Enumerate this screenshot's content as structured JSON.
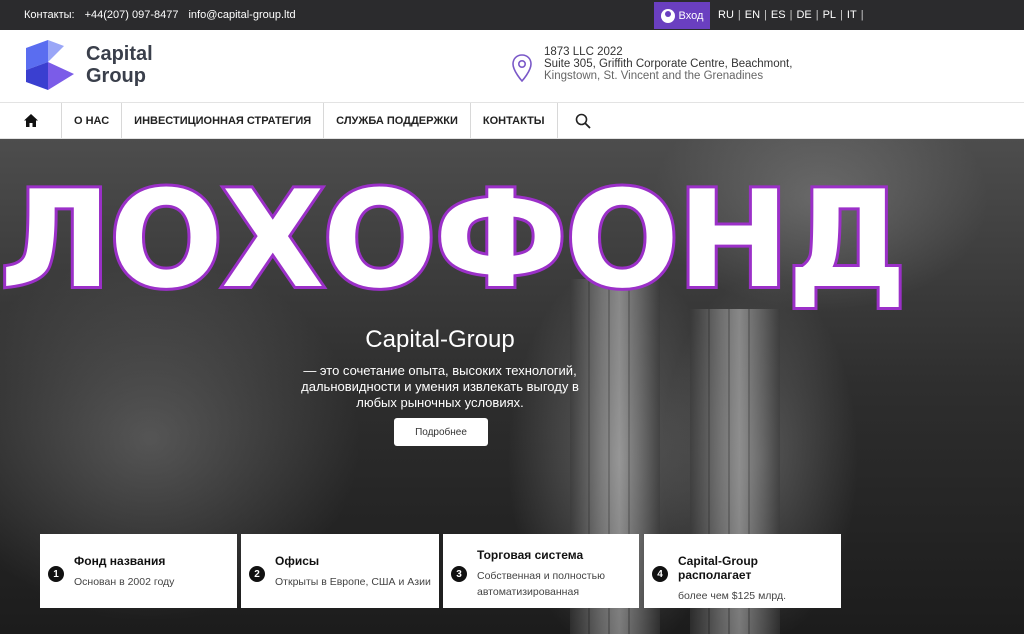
{
  "topbar": {
    "contacts_label": "Контакты:",
    "phone": "+44(207) 097-8477",
    "email": "info@capital-group.ltd",
    "login_label": "Вход",
    "languages": [
      "RU",
      "EN",
      "ES",
      "DE",
      "PL",
      "IT"
    ]
  },
  "header": {
    "logo_line1": "Capital",
    "logo_line2": "Group",
    "address_line1": "1873 LLC 2022",
    "address_line2": "Suite 305, Griffith Corporate Centre, Beachmont,",
    "address_line3": "Kingstown, St. Vincent and the Grenadines"
  },
  "nav": {
    "items": [
      "О НАС",
      "ИНВЕСТИЦИОННАЯ СТРАТЕГИЯ",
      "СЛУЖБА ПОДДЕРЖКИ",
      "КОНТАКТЫ"
    ]
  },
  "hero": {
    "watermark": "ЛОХОФОНД",
    "title": "Capital-Group",
    "description": "— это сочетание опыта, высоких технологий, дальновидности и умения извлекать выгоду в любых рыночных условиях.",
    "button_label": "Подробнее"
  },
  "features": [
    {
      "num": "1",
      "title": "Фонд названия",
      "desc": "Основан в 2002 году"
    },
    {
      "num": "2",
      "title": "Офисы",
      "desc": "Открыты в Европе, США и Азии"
    },
    {
      "num": "3",
      "title": "Торговая система",
      "desc": "Собственная и полностью автоматизированная"
    },
    {
      "num": "4",
      "title": "Capital-Group располагает",
      "desc": "более чем $125 млрд."
    }
  ],
  "colors": {
    "accent_purple": "#6a3fc0",
    "watermark_outline": "#9b30c8",
    "topbar_bg": "#2b2b2d"
  }
}
